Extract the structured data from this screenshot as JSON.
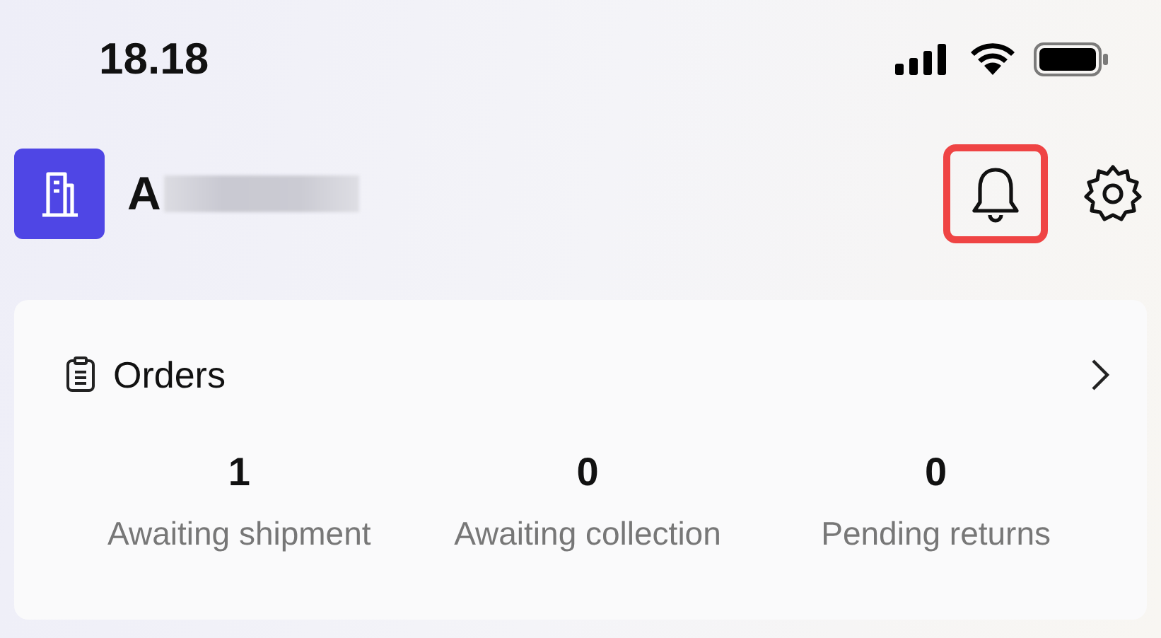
{
  "status_bar": {
    "time": "18.18"
  },
  "header": {
    "shop_name": "A",
    "name_blurred": true,
    "notifications": {
      "highlighted": true
    }
  },
  "orders": {
    "title": "Orders",
    "stats": [
      {
        "count": "1",
        "label": "Awaiting shipment"
      },
      {
        "count": "0",
        "label": "Awaiting collection"
      },
      {
        "count": "0",
        "label": "Pending returns"
      }
    ]
  }
}
